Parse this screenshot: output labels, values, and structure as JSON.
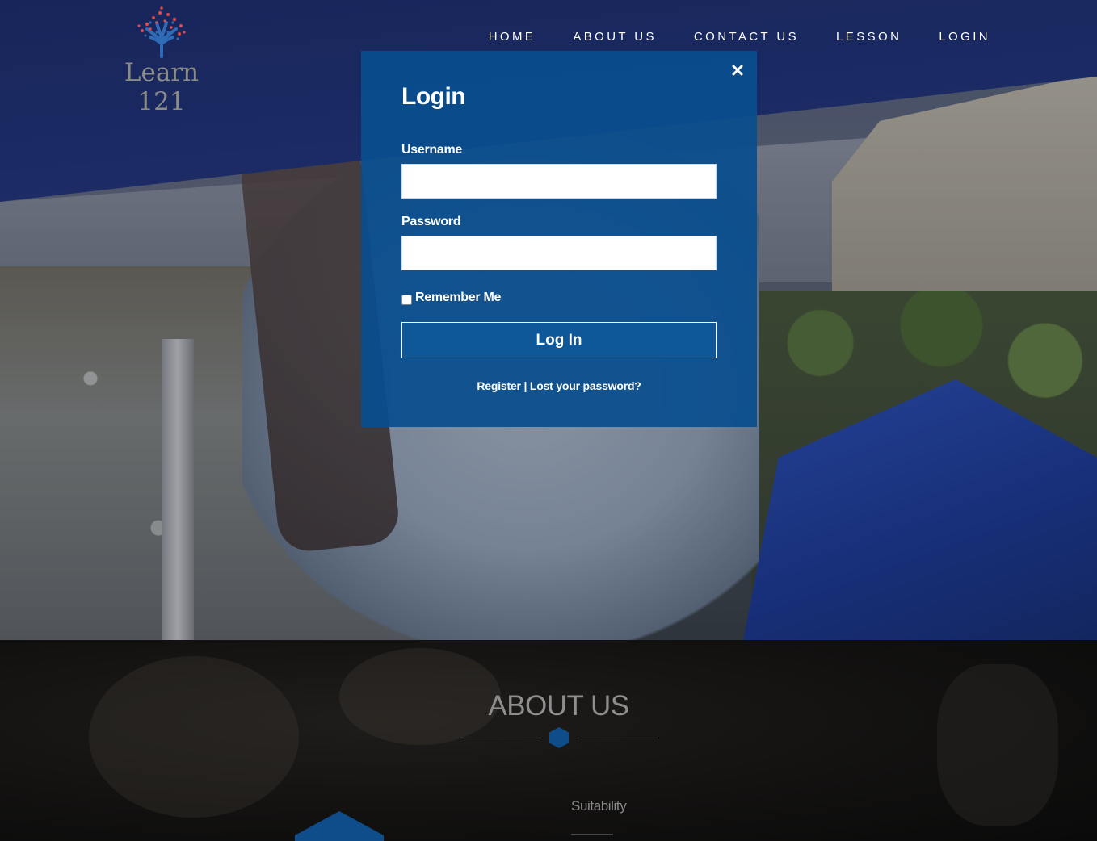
{
  "brand": {
    "logo_word": "Learn",
    "logo_number": "121"
  },
  "nav": {
    "items": [
      "HOME",
      "ABOUT US",
      "CONTACT US",
      "LESSON",
      "LOGIN"
    ]
  },
  "login_modal": {
    "title": "Login",
    "username_label": "Username",
    "username_value": "",
    "password_label": "Password",
    "password_value": "",
    "remember_label": "Remember Me",
    "remember_checked": false,
    "submit_label": "Log In",
    "register_link": "Register",
    "separator": " | ",
    "lost_password_link": "Lost your password?",
    "close_icon": "close-icon"
  },
  "about": {
    "title": "ABOUT US",
    "subheading": "Suitability"
  },
  "colors": {
    "modal_bg": "#094e8e",
    "accent_hex": "#0e4d8a",
    "nav_text": "#ffffff",
    "logo_tree_red": "#d94a4a",
    "logo_tree_blue": "#2f6cb8"
  }
}
